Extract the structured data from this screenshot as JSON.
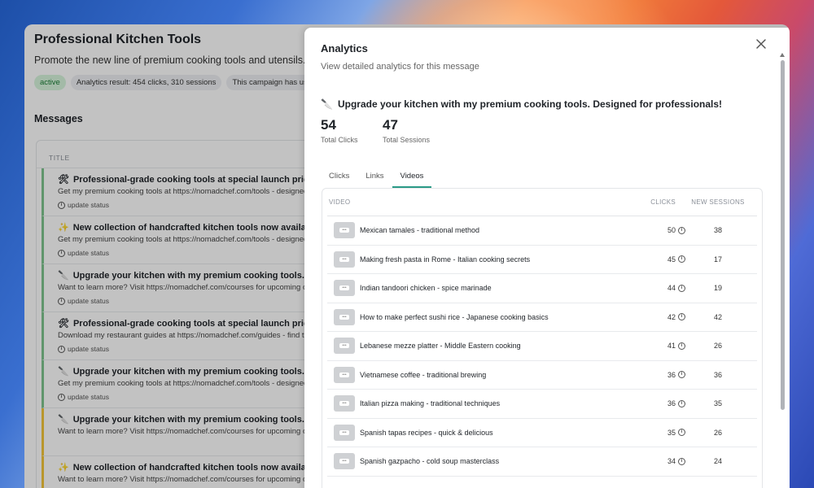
{
  "page": {
    "title": "Professional Kitchen Tools",
    "description": "Promote the new line of premium cooking tools and utensils. Ta",
    "badges": [
      "active",
      "Analytics result: 454 clicks, 310 sessions",
      "This campaign has used"
    ],
    "messages_heading": "Messages",
    "table_header": "TITLE",
    "messages": [
      {
        "icon": "🛠",
        "title": "Professional-grade cooking tools at special launch prices. Do...",
        "text": "Get my premium cooking tools at https://nomadchef.com/tools - designed f...",
        "status": "update status",
        "accent": "#7fc48f"
      },
      {
        "icon": "✨",
        "title": "New collection of handcrafted kitchen tools now available. Li...",
        "text": "Get my premium cooking tools at https://nomadchef.com/tools - designed f...",
        "status": "update status",
        "accent": "#7fc48f"
      },
      {
        "icon": "🔪",
        "title": "Upgrade your kitchen with my premium cooking tools. Desig...",
        "text": "Want to learn more? Visit https://nomadchef.com/courses for upcoming co...",
        "status": "update status",
        "accent": "#7fc48f"
      },
      {
        "icon": "🛠",
        "title": "Professional-grade cooking tools at special launch prices. Do...",
        "text": "Download my restaurant guides at https://nomadchef.com/guides - find the...",
        "status": "update status",
        "accent": "#7fc48f"
      },
      {
        "icon": "🔪",
        "title": "Upgrade your kitchen with my premium cooking tools. Desig...",
        "text": "Get my premium cooking tools at https://nomadchef.com/tools - designed f...",
        "status": "update status",
        "accent": "#7fc48f"
      },
      {
        "icon": "🔪",
        "title": "Upgrade your kitchen with my premium cooking tools. Desig...",
        "text": "Want to learn more? Visit https://nomadchef.com/courses for upcoming co...",
        "status": "",
        "accent": "#f3c63a"
      },
      {
        "icon": "✨",
        "title": "New collection of handcrafted kitchen tools now available. Li...",
        "text": "Want to learn more? Visit https://nomadchef.com/courses for upcoming co...",
        "status": "",
        "accent": "#f3c63a"
      }
    ]
  },
  "panel": {
    "title": "Analytics",
    "subtitle": "View detailed analytics for this message",
    "message_icon": "🔪",
    "message": "Upgrade your kitchen with my premium cooking tools. Designed for professionals!",
    "stats": {
      "clicks_value": "54",
      "clicks_label": "Total Clicks",
      "sessions_value": "47",
      "sessions_label": "Total Sessions"
    },
    "tabs": [
      "Clicks",
      "Links",
      "Videos"
    ],
    "active_tab": "Videos",
    "table_headers": {
      "video": "VIDEO",
      "clicks": "CLICKS",
      "sessions": "NEW SESSIONS"
    },
    "videos": [
      {
        "title": "Mexican tamales - traditional method",
        "clicks": "50",
        "sessions": "38"
      },
      {
        "title": "Making fresh pasta in Rome - Italian cooking secrets",
        "clicks": "45",
        "sessions": "17"
      },
      {
        "title": "Indian tandoori chicken - spice marinade",
        "clicks": "44",
        "sessions": "19"
      },
      {
        "title": "How to make perfect sushi rice - Japanese cooking basics",
        "clicks": "42",
        "sessions": "42"
      },
      {
        "title": "Lebanese mezze platter - Middle Eastern cooking",
        "clicks": "41",
        "sessions": "26"
      },
      {
        "title": "Vietnamese coffee - traditional brewing",
        "clicks": "36",
        "sessions": "36"
      },
      {
        "title": "Italian pizza making - traditional techniques",
        "clicks": "36",
        "sessions": "35"
      },
      {
        "title": "Spanish tapas recipes - quick & delicious",
        "clicks": "35",
        "sessions": "26"
      },
      {
        "title": "Spanish gazpacho - cold soup masterclass",
        "clicks": "34",
        "sessions": "24"
      }
    ]
  },
  "colors": {
    "active_tab_underline": "#2a9a86",
    "active_badge_bg": "#d6f5dc",
    "active_badge_text": "#1a7d35"
  }
}
